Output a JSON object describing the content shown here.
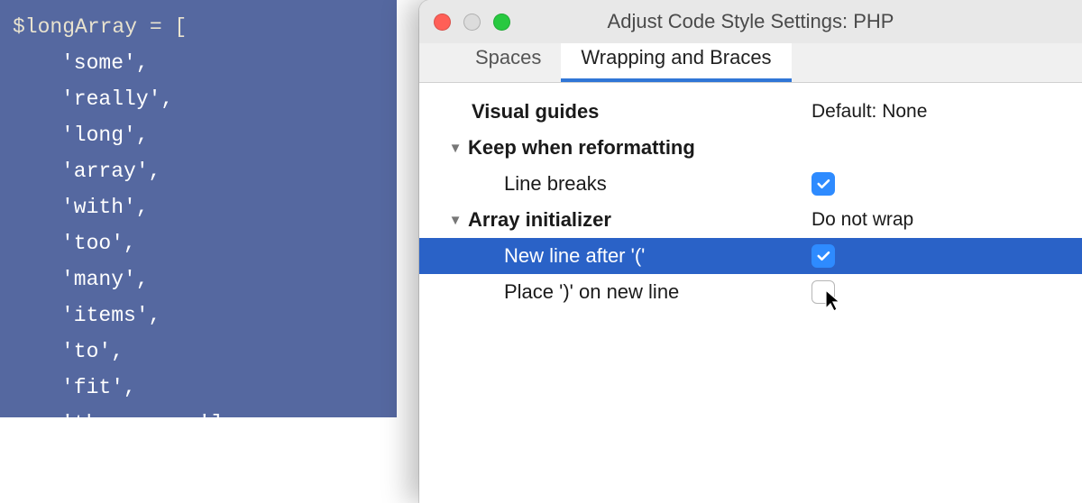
{
  "editor": {
    "first_line": "$longArray = [",
    "items": [
      "'some'",
      "'really'",
      "'long'",
      "'array'",
      "'with'",
      "'too'",
      "'many'",
      "'items'",
      "'to'",
      "'fit'",
      "'the screen'"
    ]
  },
  "dialog": {
    "title": "Adjust Code Style Settings: PHP",
    "tabs": {
      "spaces": "Spaces",
      "wrapping": "Wrapping and Braces"
    },
    "sections": {
      "visual_guides": {
        "label": "Visual guides",
        "value": "Default: None"
      },
      "keep": {
        "label": "Keep when reformatting",
        "line_breaks": {
          "label": "Line breaks",
          "checked": true
        }
      },
      "array_init": {
        "label": "Array initializer",
        "value": "Do not wrap",
        "new_line_after": {
          "label": "New line after '('",
          "checked": true
        },
        "place_on_new_line": {
          "label": "Place ')' on new line",
          "checked": false
        }
      }
    }
  }
}
